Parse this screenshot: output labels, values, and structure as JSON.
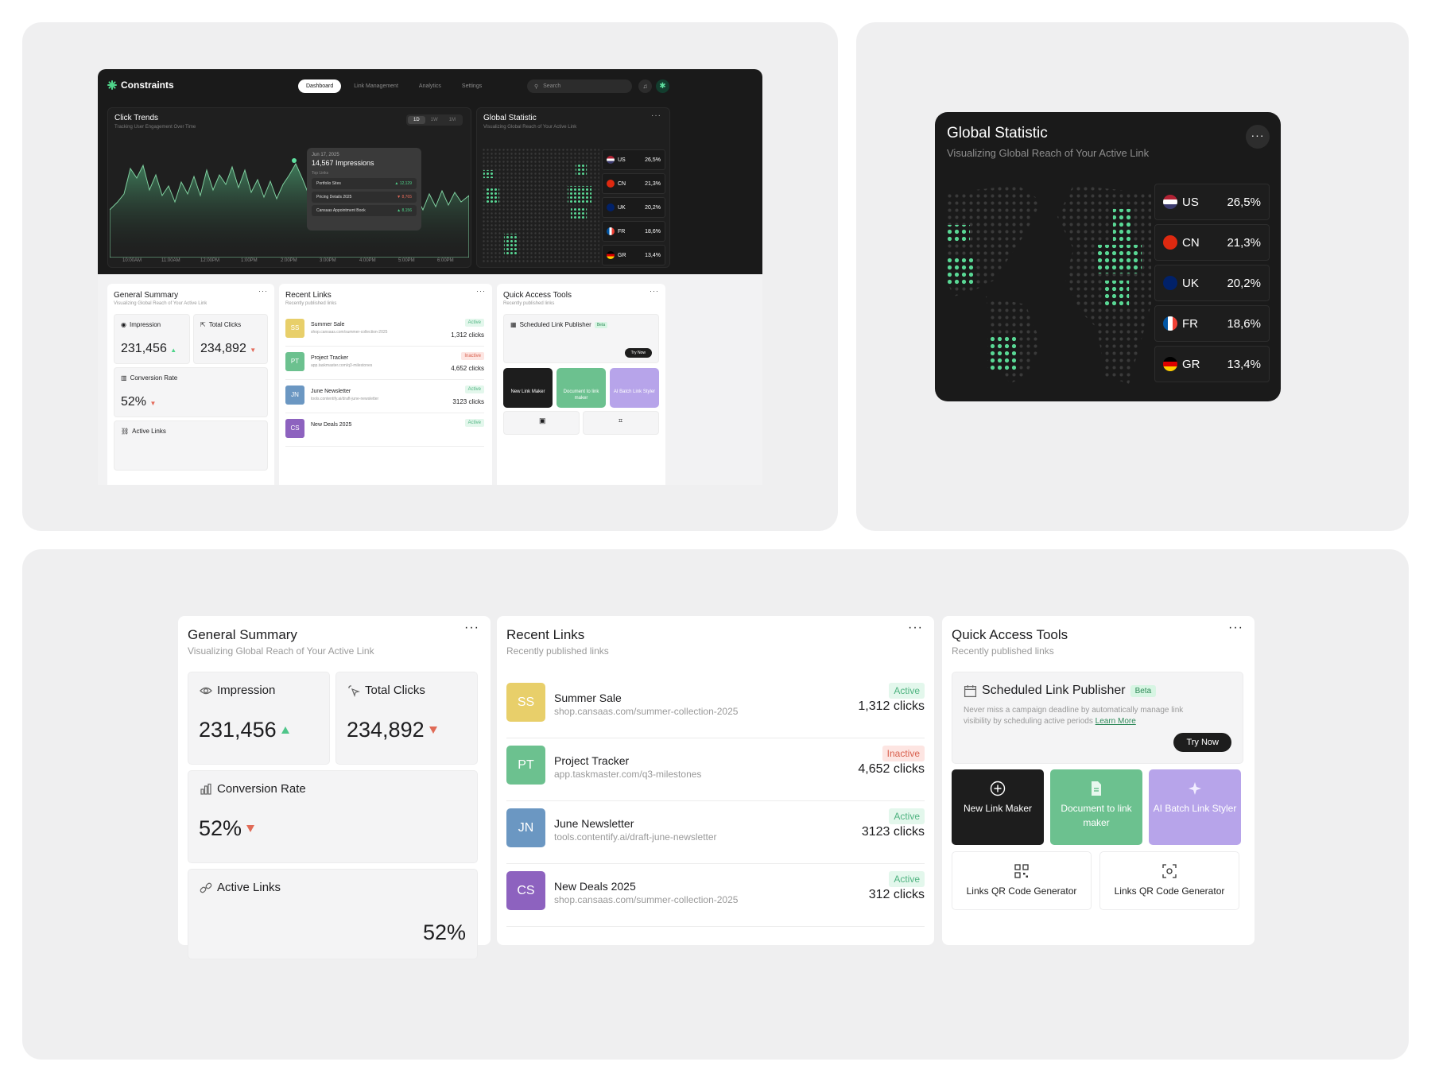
{
  "brand": {
    "name": "Constraints",
    "accent": "#4fd48a"
  },
  "nav": {
    "tabs": [
      "Dashboard",
      "Link Management",
      "Analytics",
      "Settings"
    ],
    "search_placeholder": "Search"
  },
  "click_trends": {
    "title": "Click Trends",
    "subtitle": "Tracking User Engagement Over Time",
    "ranges": [
      "1D",
      "1W",
      "1M"
    ],
    "tooltip": {
      "date": "Jun 17, 2025",
      "impressions": "14,567 Impressions",
      "top_links_label": "Top Links",
      "links": [
        {
          "name": "Portfolio Sites",
          "value": "▲ 12,129"
        },
        {
          "name": "Pricing Details 2025",
          "value": "▼ 8,765"
        },
        {
          "name": "Cansaas Appointment Book",
          "value": "▲ 8,156"
        }
      ]
    },
    "x_ticks": [
      "10:00AM",
      "11:00AM",
      "12:00PM",
      "1:00PM",
      "2:00PM",
      "3:00PM",
      "4:00PM",
      "5:00PM",
      "6:00PM"
    ]
  },
  "global": {
    "title": "Global Statistic",
    "subtitle": "Visualizing Global Reach of Your Active Link",
    "countries": [
      {
        "code": "US",
        "value": "26,5%"
      },
      {
        "code": "CN",
        "value": "21,3%"
      },
      {
        "code": "UK",
        "value": "20,2%"
      },
      {
        "code": "FR",
        "value": "18,6%"
      },
      {
        "code": "GR",
        "value": "13,4%"
      }
    ]
  },
  "summary": {
    "title": "General Summary",
    "subtitle": "Visualizing Global Reach of Your Active Link",
    "impression_label": "Impression",
    "impression": "231,456",
    "clicks_label": "Total Clicks",
    "clicks": "234,892",
    "conversion_label": "Conversion Rate",
    "conversion": "52%",
    "active_label": "Active Links",
    "active": "52%"
  },
  "recent": {
    "title": "Recent Links",
    "subtitle": "Recently published links",
    "items": [
      {
        "initials": "SS",
        "name": "Summer Sale",
        "url": "shop.cansaas.com/summer-collection-2025",
        "status": "Active",
        "clicks": "1,312 clicks",
        "color": "#e8cf6a"
      },
      {
        "initials": "PT",
        "name": "Project Tracker",
        "url": "app.taskmaster.com/q3-milestones",
        "status": "Inactive",
        "clicks": "4,652 clicks",
        "color": "#6cc18f"
      },
      {
        "initials": "JN",
        "name": "June Newsletter",
        "url": "tools.contentify.ai/draft-june-newsletter",
        "status": "Active",
        "clicks": "3123 clicks",
        "color": "#6b97c2"
      },
      {
        "initials": "CS",
        "name": "New Deals 2025",
        "url": "shop.cansaas.com/summer-collection-2025",
        "status": "Active",
        "clicks": "312 clicks",
        "color": "#8d62bf"
      }
    ]
  },
  "quick": {
    "title": "Quick Access Tools",
    "subtitle": "Recently published links",
    "publisher": "Scheduled Link Publisher",
    "beta": "Beta",
    "desc": "Never miss a campaign deadline by automatically manage link visibility by scheduling active periods",
    "learn": "Learn More",
    "try": "Try Now",
    "tiles": [
      "New Link Maker",
      "Document to link maker",
      "AI Batch Link Styler"
    ],
    "qr": [
      "Links QR Code Generator",
      "Links QR Code Generator"
    ]
  }
}
